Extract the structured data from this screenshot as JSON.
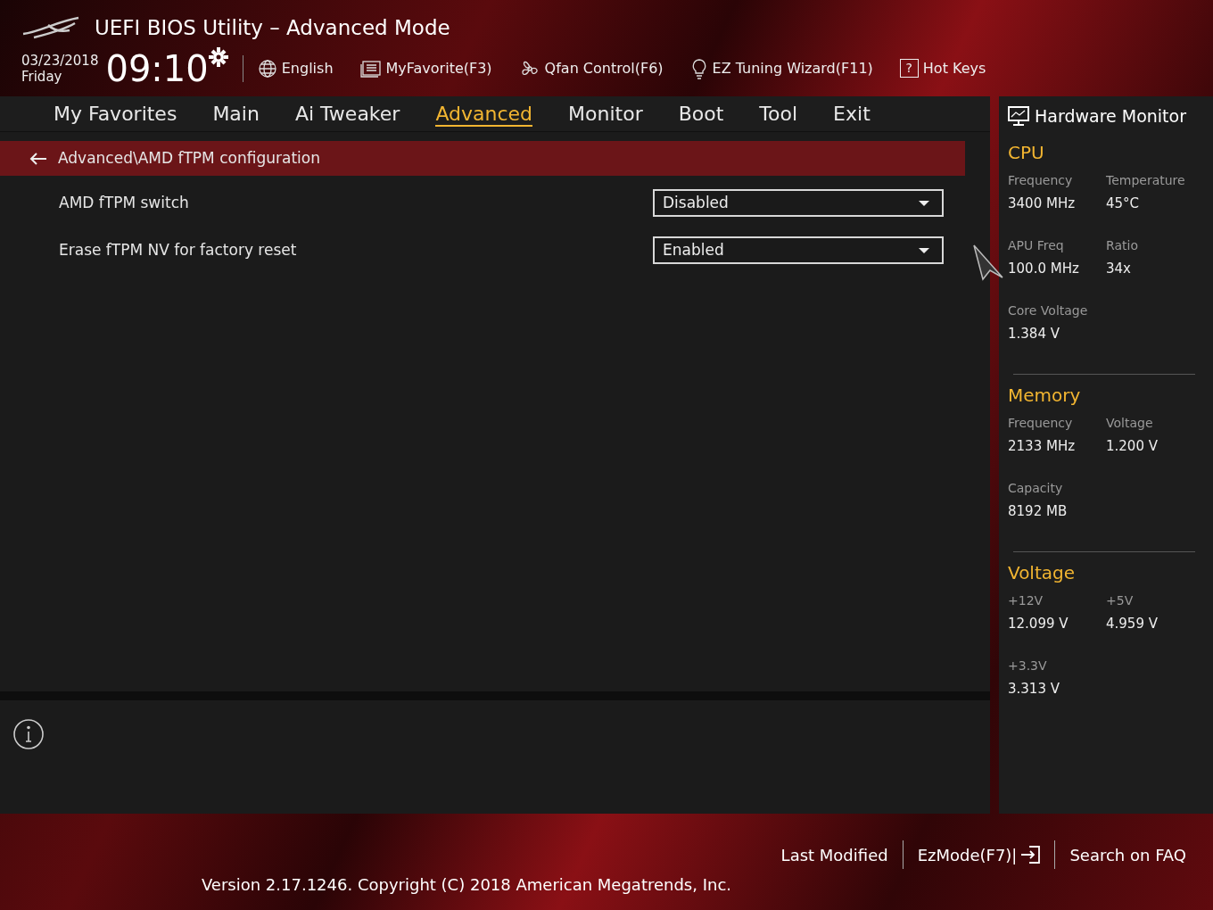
{
  "window": {
    "title": "UEFI BIOS Utility – Advanced Mode"
  },
  "header": {
    "date": "03/23/2018",
    "day": "Friday",
    "time": "09:10",
    "tools": [
      {
        "kind": "language",
        "label": "English"
      },
      {
        "kind": "favorite",
        "label": "MyFavorite(F3)"
      },
      {
        "kind": "fan",
        "label": "Qfan Control(F6)"
      },
      {
        "kind": "wizard",
        "label": "EZ Tuning Wizard(F11)"
      },
      {
        "kind": "hotkeys",
        "label": "Hot Keys",
        "key_glyph": "?"
      }
    ]
  },
  "tabs": [
    {
      "label": "My Favorites",
      "selected": false
    },
    {
      "label": "Main",
      "selected": false
    },
    {
      "label": "Ai Tweaker",
      "selected": false
    },
    {
      "label": "Advanced",
      "selected": true
    },
    {
      "label": "Monitor",
      "selected": false
    },
    {
      "label": "Boot",
      "selected": false
    },
    {
      "label": "Tool",
      "selected": false
    },
    {
      "label": "Exit",
      "selected": false
    }
  ],
  "breadcrumb": "Advanced\\AMD fTPM configuration",
  "settings": [
    {
      "label": "AMD fTPM switch",
      "value": "Disabled"
    },
    {
      "label": "Erase fTPM NV for factory reset",
      "value": "Enabled"
    }
  ],
  "hardware_monitor": {
    "title": "Hardware Monitor",
    "sections": [
      {
        "title": "CPU",
        "items": [
          {
            "label": "Frequency",
            "value": "3400 MHz"
          },
          {
            "label": "Temperature",
            "value": "45°C"
          },
          {
            "label": "APU Freq",
            "value": "100.0 MHz"
          },
          {
            "label": "Ratio",
            "value": "34x"
          },
          {
            "label": "Core Voltage",
            "value": "1.384 V"
          }
        ]
      },
      {
        "title": "Memory",
        "items": [
          {
            "label": "Frequency",
            "value": "2133 MHz"
          },
          {
            "label": "Voltage",
            "value": "1.200 V"
          },
          {
            "label": "Capacity",
            "value": "8192 MB"
          }
        ]
      },
      {
        "title": "Voltage",
        "items": [
          {
            "label": "+12V",
            "value": "12.099 V"
          },
          {
            "label": "+5V",
            "value": "4.959 V"
          },
          {
            "label": "+3.3V",
            "value": "3.313 V"
          }
        ]
      }
    ]
  },
  "footer": {
    "actions": [
      {
        "kind": "text",
        "label": "Last Modified"
      },
      {
        "kind": "ezmode",
        "label": "EzMode(F7)|"
      },
      {
        "kind": "text",
        "label": "Search on FAQ"
      }
    ],
    "version": "Version 2.17.1246. Copyright (C) 2018 American Megatrends, Inc."
  }
}
